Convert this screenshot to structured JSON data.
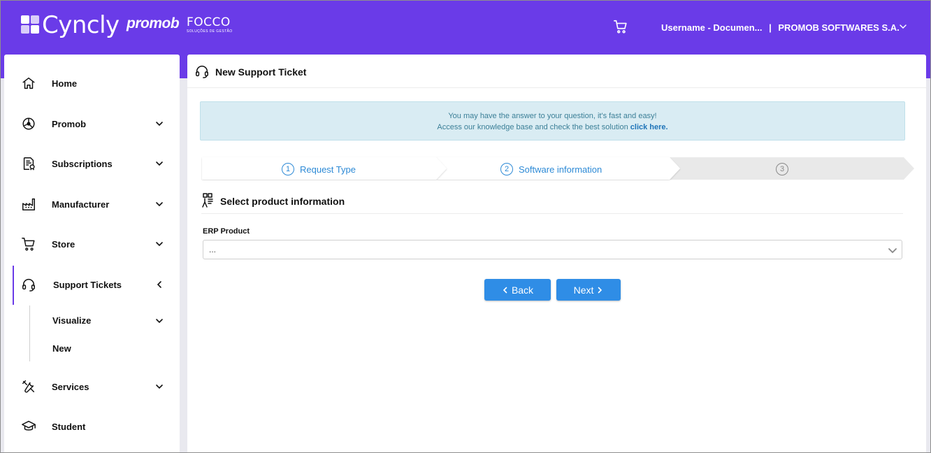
{
  "header": {
    "brand": "Cyncly",
    "partner1": "promob",
    "partner2": "FOCCO",
    "partner2_tagline": "SOLUÇÕES DE GESTÃO",
    "user_label": "Username - Documen...",
    "separator": "|",
    "company": "PROMOB SOFTWARES S.A.",
    "icons": [
      "cart-icon",
      "chevron-down-icon"
    ]
  },
  "sidebar": {
    "items": [
      {
        "label": "Home",
        "icon": "home-icon",
        "expandable": false
      },
      {
        "label": "Promob",
        "icon": "promob-icon",
        "expandable": true
      },
      {
        "label": "Subscriptions",
        "icon": "subscriptions-icon",
        "expandable": true
      },
      {
        "label": "Manufacturer",
        "icon": "factory-icon",
        "expandable": true
      },
      {
        "label": "Store",
        "icon": "cart-icon",
        "expandable": true
      },
      {
        "label": "Support Tickets",
        "icon": "headset-icon",
        "expandable": true,
        "active": true
      },
      {
        "label": "Services",
        "icon": "tools-icon",
        "expandable": true
      },
      {
        "label": "Student",
        "icon": "graduation-cap-icon",
        "expandable": false
      }
    ],
    "support_sub": [
      {
        "label": "Visualize"
      },
      {
        "label": "New"
      }
    ]
  },
  "main": {
    "title": "New Support Ticket",
    "info": {
      "line1": "You may have the answer to your question, it's fast and easy!",
      "line2": "Access our knowledge base and check the best solution",
      "link": "click here."
    },
    "steps": [
      {
        "num": "1",
        "label": "Request Type"
      },
      {
        "num": "2",
        "label": "Software information"
      },
      {
        "num": "3",
        "label": ""
      }
    ],
    "section_title": "Select product information",
    "field_label": "ERP Product",
    "field_value": "...",
    "back_label": "Back",
    "next_label": "Next"
  },
  "colors": {
    "brand": "#6a3be8",
    "primary_button": "#2f8de6",
    "info_bg": "#d9ecf3"
  }
}
